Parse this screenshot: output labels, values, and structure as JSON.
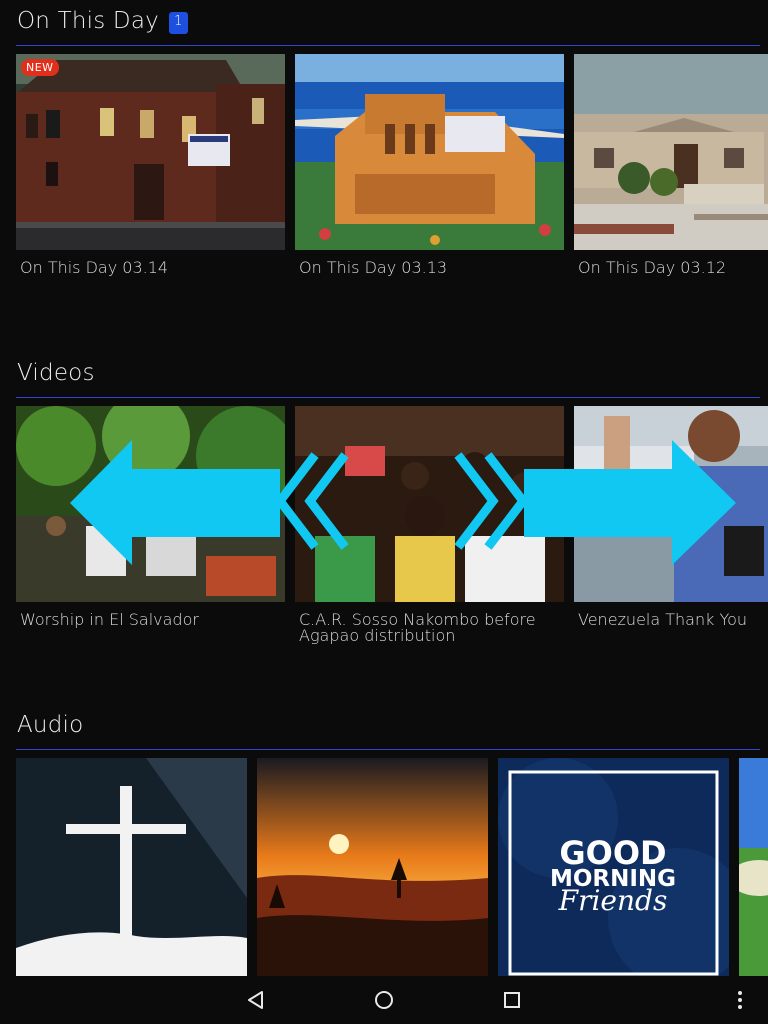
{
  "on_this_day": {
    "title": "On This Day",
    "badge": "1",
    "new_label": "NEW",
    "items": [
      {
        "caption": "On This Day 03.14"
      },
      {
        "caption": "On This Day 03.13"
      },
      {
        "caption": "On This Day 03.12"
      }
    ]
  },
  "videos": {
    "title": "Videos",
    "items": [
      {
        "caption": "Worship in El Salvador"
      },
      {
        "caption": "C.A.R. Sosso Nakombo before Agapao distribution"
      },
      {
        "caption": "Venezuela Thank You"
      }
    ]
  },
  "audio": {
    "title": "Audio",
    "items": [
      {
        "name": "cross"
      },
      {
        "name": "sunset"
      },
      {
        "name": "good-morning"
      },
      {
        "name": "field"
      }
    ],
    "good_morning_line1": "GOOD",
    "good_morning_line2": "MORNING",
    "good_morning_line3": "Friends"
  },
  "colors": {
    "accent": "#2b48c9",
    "badge": "#1d4fe0",
    "new_badge": "#e0301c",
    "swipe_arrow": "#10c8f2"
  },
  "nav": {
    "back_icon": "back-triangle-icon",
    "home_icon": "home-circle-icon",
    "recents_icon": "recents-square-icon",
    "menu_icon": "overflow-menu-icon"
  }
}
